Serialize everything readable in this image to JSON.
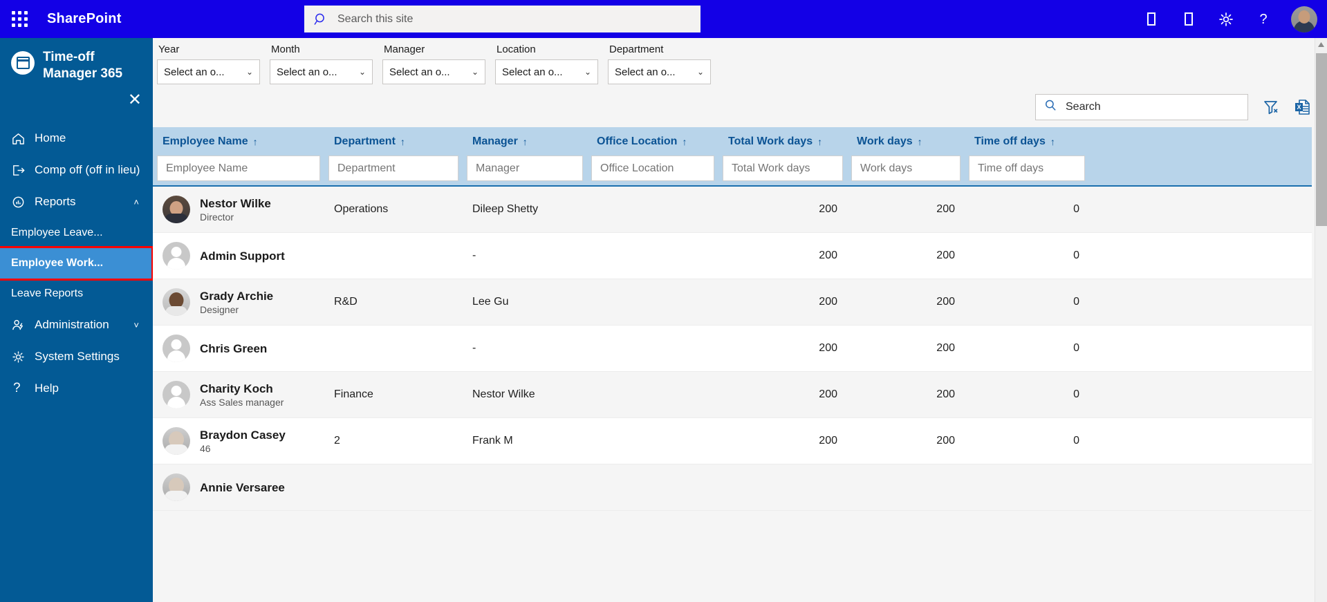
{
  "suite": {
    "app_launcher": "waffle-icon",
    "title": "SharePoint",
    "search_placeholder": "Search this site",
    "icons": [
      "tofu-box-icon",
      "tofu-box-icon",
      "gear-icon",
      "help-icon"
    ],
    "help_glyph": "?",
    "gear_glyph": "⚙"
  },
  "sidebar": {
    "brand_line1": "Time-off",
    "brand_line2": "Manager 365",
    "close_glyph": "✕",
    "items": [
      {
        "label": "Home",
        "icon": "home-icon"
      },
      {
        "label": "Comp off (off in lieu)",
        "icon": "signout-icon"
      },
      {
        "label": "Reports",
        "icon": "reports-icon",
        "chevron": "˄",
        "expanded": true
      }
    ],
    "sub_items": [
      {
        "label": "Employee Leave...",
        "active": false
      },
      {
        "label": "Employee Work...",
        "active": true
      },
      {
        "label": "Leave Reports",
        "active": false
      }
    ],
    "items_bottom": [
      {
        "label": "Administration",
        "icon": "admin-user-icon",
        "chevron": "˅"
      },
      {
        "label": "System Settings",
        "icon": "gear-icon"
      },
      {
        "label": "Help",
        "icon": "help-icon"
      }
    ]
  },
  "filters": [
    {
      "label": "Year",
      "value": "Select an o..."
    },
    {
      "label": "Month",
      "value": "Select an o..."
    },
    {
      "label": "Manager",
      "value": "Select an o..."
    },
    {
      "label": "Location",
      "value": "Select an o..."
    },
    {
      "label": "Department",
      "value": "Select an o..."
    }
  ],
  "toolbar": {
    "search_placeholder": "Search",
    "clear_filter_icon": "filter-clear-icon",
    "export_excel_icon": "excel-export-icon"
  },
  "table": {
    "sort_arrow": "↑",
    "columns": [
      {
        "key": "name",
        "label": "Employee Name",
        "filter_placeholder": "Employee Name",
        "align": "left"
      },
      {
        "key": "dept",
        "label": "Department",
        "filter_placeholder": "Department",
        "align": "left"
      },
      {
        "key": "manager",
        "label": "Manager",
        "filter_placeholder": "Manager",
        "align": "left"
      },
      {
        "key": "office",
        "label": "Office Location",
        "filter_placeholder": "Office Location",
        "align": "left"
      },
      {
        "key": "total",
        "label": "Total Work days",
        "filter_placeholder": "Total Work days",
        "align": "right"
      },
      {
        "key": "work",
        "label": "Work days",
        "filter_placeholder": "Work days",
        "align": "right"
      },
      {
        "key": "timeoff",
        "label": "Time off days",
        "filter_placeholder": "Time off days",
        "align": "right"
      }
    ],
    "rows": [
      {
        "name": "Nestor Wilke",
        "role": "Director",
        "avatar": "p1",
        "dept": "Operations",
        "manager": "Dileep Shetty",
        "office": "",
        "total": "200",
        "work": "200",
        "timeoff": "0"
      },
      {
        "name": "Admin Support",
        "role": "",
        "avatar": "generic",
        "dept": "",
        "manager": "-",
        "office": "",
        "total": "200",
        "work": "200",
        "timeoff": "0"
      },
      {
        "name": "Grady Archie",
        "role": "Designer",
        "avatar": "p2",
        "dept": "R&D",
        "manager": "Lee Gu",
        "office": "",
        "total": "200",
        "work": "200",
        "timeoff": "0"
      },
      {
        "name": "Chris Green",
        "role": "",
        "avatar": "generic",
        "dept": "",
        "manager": "-",
        "office": "",
        "total": "200",
        "work": "200",
        "timeoff": "0"
      },
      {
        "name": "Charity Koch",
        "role": "Ass Sales manager",
        "avatar": "generic",
        "dept": "Finance",
        "manager": "Nestor Wilke",
        "office": "",
        "total": "200",
        "work": "200",
        "timeoff": "0"
      },
      {
        "name": "Braydon Casey",
        "role": "46",
        "avatar": "p3",
        "dept": "2",
        "manager": "Frank M",
        "office": "",
        "total": "200",
        "work": "200",
        "timeoff": "0"
      },
      {
        "name": "Annie Versaree",
        "role": "",
        "avatar": "p3",
        "dept": "",
        "manager": "",
        "office": "",
        "total": "",
        "work": "",
        "timeoff": ""
      }
    ]
  },
  "scrollbar": {
    "up_arrow": "▲"
  },
  "colors": {
    "suite_bar": "#1300e6",
    "sidebar": "#035a95",
    "active_item": "#3b8fd4",
    "highlight_outline": "#ff0000",
    "header_row": "#b8d4ea",
    "header_text": "#0b5394"
  }
}
